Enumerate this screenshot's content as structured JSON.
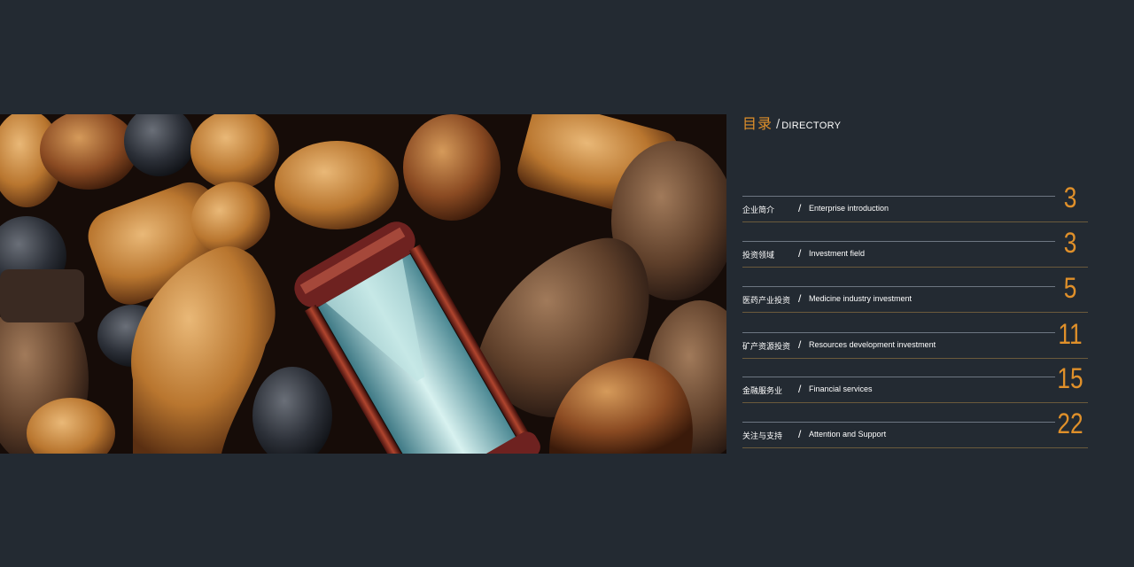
{
  "directory": {
    "title_cn": "目录",
    "title_sep": "/",
    "title_en": "DIRECTORY",
    "entries": [
      {
        "cn": "企业简介",
        "en": "Enterprise introduction",
        "page": "3"
      },
      {
        "cn": "投资领域",
        "en": "Investment field",
        "page": "3"
      },
      {
        "cn": "医药产业投资",
        "en": "Medicine industry investment",
        "page": "5"
      },
      {
        "cn": "矿产资源投资",
        "en": "Resources development investment",
        "page": "11"
      },
      {
        "cn": "金融服务业",
        "en": "Financial services",
        "page": "15"
      },
      {
        "cn": "关注与支持",
        "en": "Attention and Support",
        "page": "22"
      }
    ],
    "entry_sep": "/"
  },
  "colors": {
    "background": "#232a32",
    "accent": "#e0902a",
    "text": "#ffffff"
  },
  "photo": {
    "subject": "chess-pieces-and-hourglass-photo"
  }
}
